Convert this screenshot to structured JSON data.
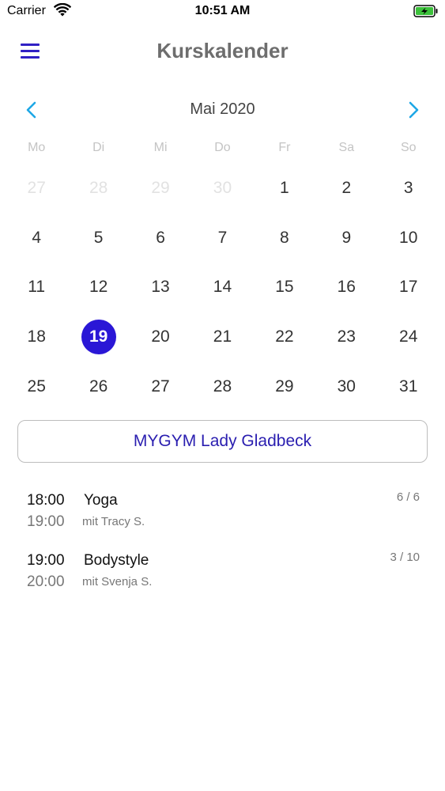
{
  "status_bar": {
    "carrier": "Carrier",
    "time": "10:51 AM"
  },
  "nav": {
    "title": "Kurskalender",
    "accent_color": "#3020c4"
  },
  "calendar": {
    "month_label": "Mai 2020",
    "weekdays": [
      "Mo",
      "Di",
      "Mi",
      "Do",
      "Fr",
      "Sa",
      "So"
    ],
    "weeks": [
      [
        {
          "d": "27",
          "muted": true
        },
        {
          "d": "28",
          "muted": true
        },
        {
          "d": "29",
          "muted": true
        },
        {
          "d": "30",
          "muted": true
        },
        {
          "d": "1"
        },
        {
          "d": "2"
        },
        {
          "d": "3"
        }
      ],
      [
        {
          "d": "4"
        },
        {
          "d": "5"
        },
        {
          "d": "6"
        },
        {
          "d": "7"
        },
        {
          "d": "8"
        },
        {
          "d": "9"
        },
        {
          "d": "10"
        }
      ],
      [
        {
          "d": "11"
        },
        {
          "d": "12"
        },
        {
          "d": "13"
        },
        {
          "d": "14"
        },
        {
          "d": "15"
        },
        {
          "d": "16"
        },
        {
          "d": "17"
        }
      ],
      [
        {
          "d": "18"
        },
        {
          "d": "19",
          "selected": true
        },
        {
          "d": "20"
        },
        {
          "d": "21"
        },
        {
          "d": "22"
        },
        {
          "d": "23"
        },
        {
          "d": "24"
        }
      ],
      [
        {
          "d": "25"
        },
        {
          "d": "26"
        },
        {
          "d": "27"
        },
        {
          "d": "28"
        },
        {
          "d": "29"
        },
        {
          "d": "30"
        },
        {
          "d": "31"
        }
      ]
    ],
    "selected_color": "#2a17d6",
    "arrow_color": "#1ea7e6"
  },
  "location": {
    "label": "MYGYM Lady Gladbeck"
  },
  "courses": [
    {
      "start": "18:00",
      "end": "19:00",
      "name": "Yoga",
      "trainer": "mit Tracy S.",
      "capacity": "6 / 6"
    },
    {
      "start": "19:00",
      "end": "20:00",
      "name": "Bodystyle",
      "trainer": "mit Svenja S.",
      "capacity": "3 / 10"
    }
  ]
}
